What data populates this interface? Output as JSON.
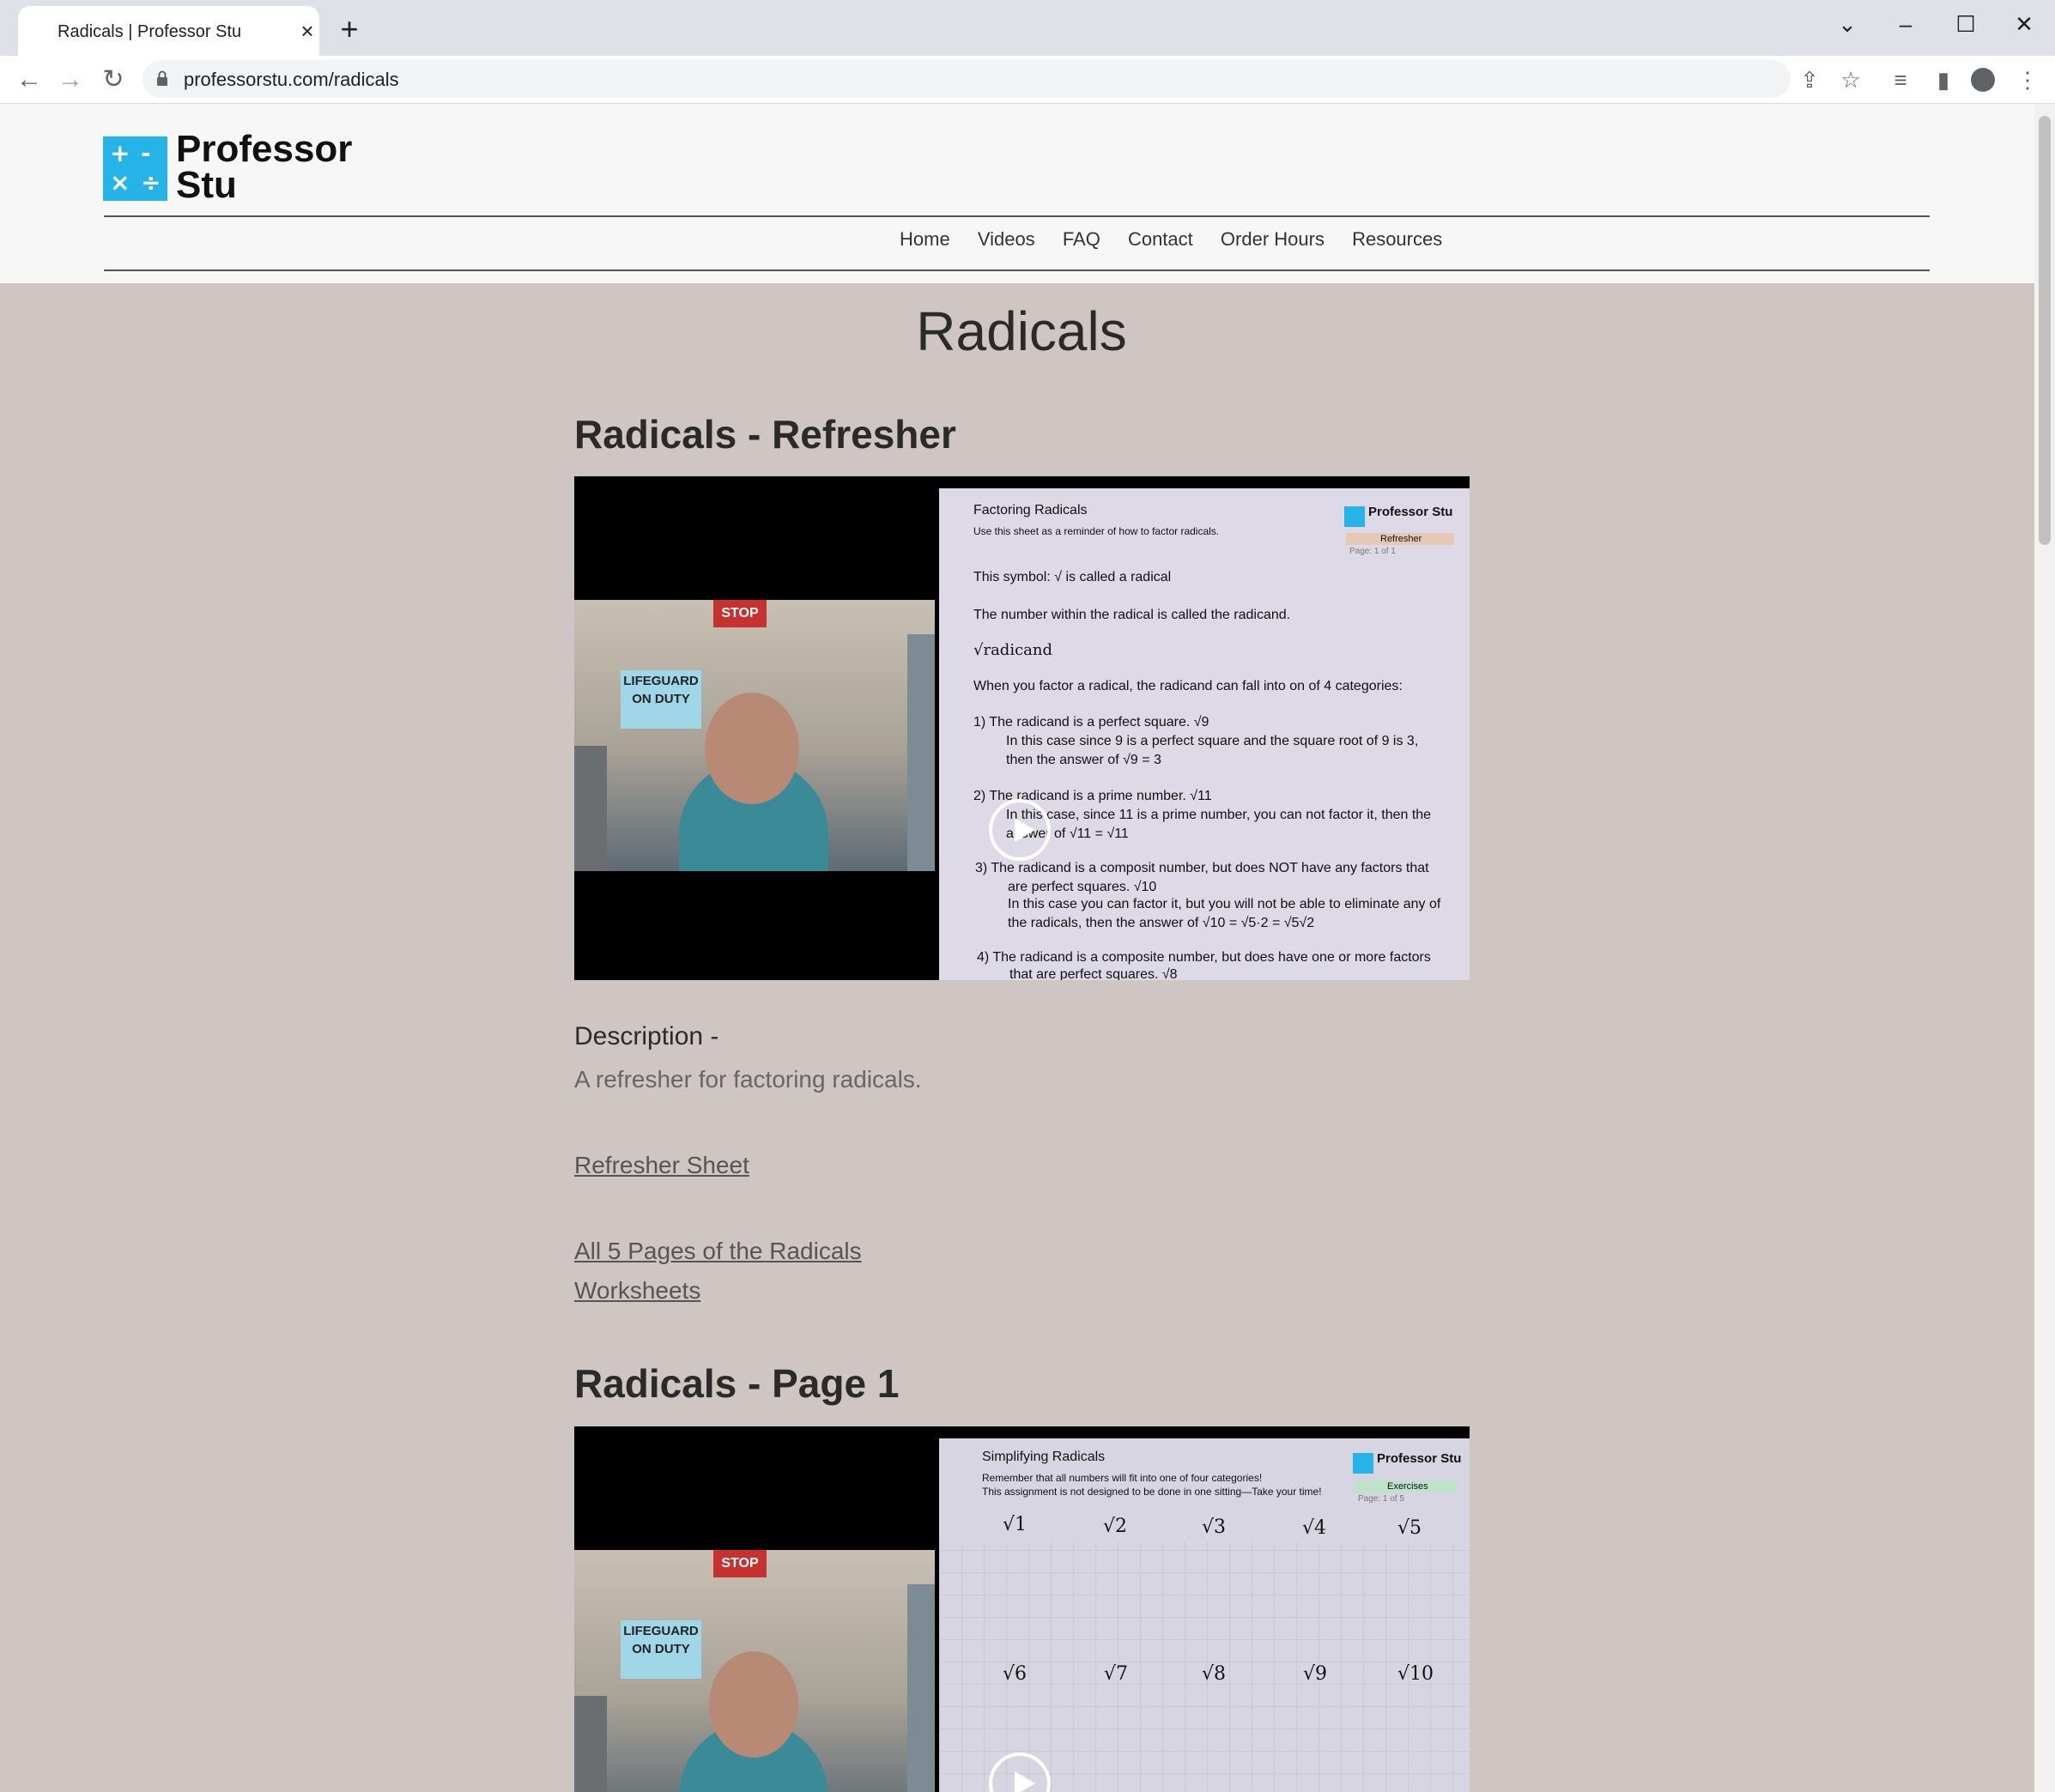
{
  "browser": {
    "tab_title": "Radicals | Professor Stu",
    "url": "professorstu.com/radicals"
  },
  "site": {
    "logo_symbols": [
      "+",
      "-",
      "×",
      "÷"
    ],
    "logo_line1": "Professor",
    "logo_line2": "Stu",
    "nav": [
      "Home",
      "Videos",
      "FAQ",
      "Contact",
      "Order Hours",
      "Resources"
    ]
  },
  "page": {
    "title": "Radicals",
    "sections": [
      {
        "heading": "Radicals - Refresher",
        "sheet_title": "Factoring Radicals",
        "sheet_subtitle": "Use this sheet as a reminder of how to factor radicals.",
        "sheet_lines": [
          "This symbol:  √ is called a radical",
          "The number within the radical is called the radicand.",
          "√radicand",
          "When you factor a radical, the radicand can fall into on of 4 categories:",
          "1) The radicand is a perfect square. √9",
          "In this case since 9 is a perfect square and the square root of 9 is 3,",
          "then the answer of √9 = 3",
          "2) The radicand is a prime number. √11",
          "In this case, since 11 is a prime number, you can not factor it, then the",
          "answer of √11 = √11",
          "3) The radicand is a composit number, but does NOT have any factors that",
          "are perfect squares. √10",
          "In this case you can factor it, but you will not be able to eliminate any of",
          "the radicals, then the answer of √10 = √5·2 = √5√2",
          "4) The radicand is a composite number, but does have one or more factors",
          "that are perfect squares. √8"
        ],
        "sheet_logo": "Professor Stu",
        "sheet_tag": "Refresher",
        "sheet_page": "Page:  1  of  1",
        "sign_text": "LIFEGUARD ON DUTY",
        "stop_text": "STOP"
      },
      {
        "heading": "Radicals - Page 1",
        "sheet_title": "Simplifying Radicals",
        "sheet_subtitle": "Remember that all numbers will fit into one of four categories!",
        "sheet_subtitle2": "This assignment is not designed to be done in one sitting—Take your time!",
        "sheet_logo": "Professor Stu",
        "sheet_tag": "Exercises",
        "sheet_page": "Page:  1  of  5",
        "radicals_row1": [
          "√1",
          "√2",
          "√3",
          "√4",
          "√5"
        ],
        "radicals_row2": [
          "√6",
          "√7",
          "√8",
          "√9",
          "√10"
        ],
        "sign_text": "LIFEGUARD ON DUTY",
        "stop_text": "STOP"
      }
    ],
    "description_label": "Description -",
    "description_text": "A refresher for factoring radicals.",
    "link_refresher": "Refresher Sheet",
    "link_all_line1": "All 5 Pages of the Radicals",
    "link_all_line2": "Worksheets"
  }
}
